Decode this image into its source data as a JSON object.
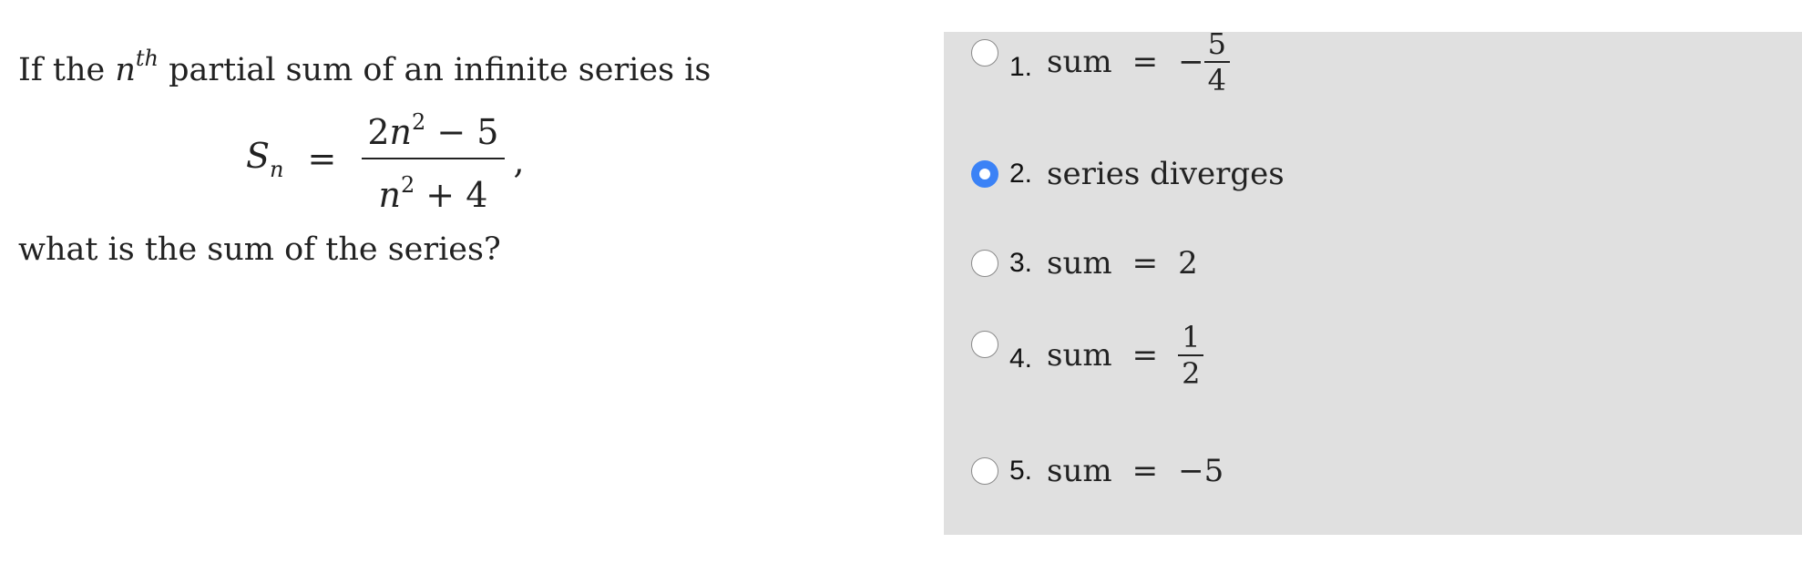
{
  "question": {
    "line1_prefix": "If the ",
    "line1_n": "n",
    "line1_sup": "th",
    "line1_suffix": " partial sum of an infinite series is",
    "formula": {
      "lhs": "S",
      "lhs_sub": "n",
      "eq": "=",
      "num_prefix": "2",
      "num_var": "n",
      "num_sup": "2",
      "num_suffix": " − 5",
      "den_var": "n",
      "den_sup": "2",
      "den_suffix": " + 4",
      "comma": ","
    },
    "line2": "what is the sum of the series?"
  },
  "choices": [
    {
      "number": "1.",
      "word": "sum",
      "eq": "=",
      "sign": "−",
      "frac_num": "5",
      "frac_den": "4",
      "selected": false
    },
    {
      "number": "2.",
      "text": "series diverges",
      "selected": true
    },
    {
      "number": "3.",
      "word": "sum",
      "eq": "=",
      "value": "2",
      "selected": false
    },
    {
      "number": "4.",
      "word": "sum",
      "eq": "=",
      "frac_num": "1",
      "frac_den": "2",
      "selected": false
    },
    {
      "number": "5.",
      "word": "sum",
      "eq": "=",
      "value": "−5",
      "selected": false
    }
  ],
  "colors": {
    "panel_bg": "#e0e0e0",
    "radio_selected": "#3b82f6",
    "text": "#222222"
  }
}
